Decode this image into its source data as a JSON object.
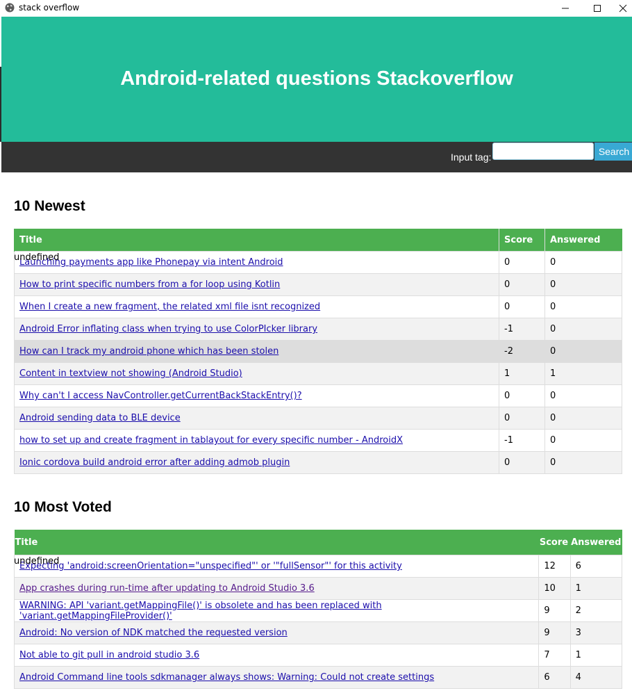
{
  "window": {
    "title": "stack overflow"
  },
  "header": {
    "title": "Android-related questions Stackoverflow"
  },
  "nav": {
    "input_label": "Input tag:",
    "input_value": "",
    "search_label": "Search"
  },
  "newest": {
    "heading": "10 Newest",
    "columns": [
      "Title",
      "Score",
      "Answered"
    ],
    "undefined_text": "undefined",
    "rows": [
      {
        "title": "Launching payments app like Phonepay via intent Android",
        "score": "0",
        "answered": "0"
      },
      {
        "title": "How to print specific numbers from a for loop using Kotlin",
        "score": "0",
        "answered": "0"
      },
      {
        "title": "When I create a new fragment, the related xml file isnt recognized",
        "score": "0",
        "answered": "0"
      },
      {
        "title": "Android Error inflating class when trying to use ColorPIcker library",
        "score": "-1",
        "answered": "0"
      },
      {
        "title": "How can I track my android phone which has been stolen",
        "score": "-2",
        "answered": "0"
      },
      {
        "title": "Content in textview not showing (Android Studio)",
        "score": "1",
        "answered": "1"
      },
      {
        "title": "Why can't I access NavController.getCurrentBackStackEntry()?",
        "score": "0",
        "answered": "0"
      },
      {
        "title": "Android sending data to BLE device",
        "score": "0",
        "answered": "0"
      },
      {
        "title": "how to set up and create fragment in tablayout for every specific number - AndroidX",
        "score": "-1",
        "answered": "0"
      },
      {
        "title": "Ionic cordova build android error after adding admob plugin",
        "score": "0",
        "answered": "0"
      }
    ]
  },
  "most_voted": {
    "heading": "10 Most Voted",
    "columns": [
      "Title",
      "Score",
      "Answered"
    ],
    "undefined_text": "undefined",
    "rows": [
      {
        "title": "Expecting 'android:screenOrientation=\"unspecified\"' or '\"fullSensor\"' for this activity",
        "score": "12",
        "answered": "6"
      },
      {
        "title": "App crashes during run-time after updating to Android Studio 3.6",
        "score": "10",
        "answered": "1"
      },
      {
        "title": "WARNING: API 'variant.getMappingFile()' is obsolete and has been replaced with 'variant.getMappingFileProvider()'",
        "score": "9",
        "answered": "2"
      },
      {
        "title": "Android: No version of NDK matched the requested version",
        "score": "9",
        "answered": "3"
      },
      {
        "title": "Not able to git pull in android studio 3.6",
        "score": "7",
        "answered": "1"
      },
      {
        "title": "Android Command line tools sdkmanager always shows: Warning: Could not create settings",
        "score": "6",
        "answered": "4"
      }
    ]
  }
}
